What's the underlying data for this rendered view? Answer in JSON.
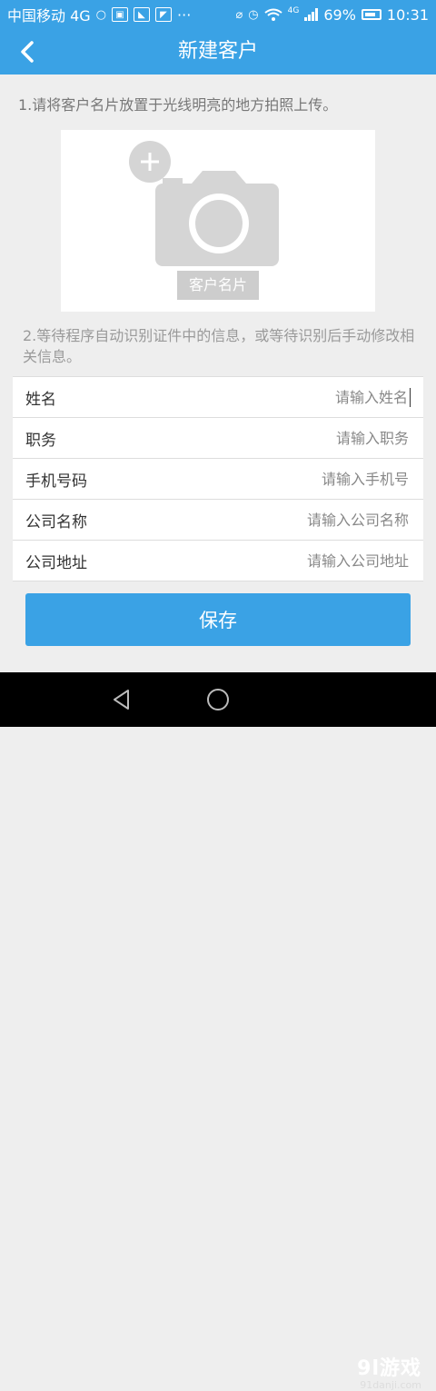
{
  "status_bar": {
    "carrier": "中国移动 4G",
    "icons": [
      "message-icon",
      "notification-icon",
      "image-icon",
      "photo-icon",
      "more-dots-icon",
      "mute-icon",
      "alarm-icon",
      "wifi-icon",
      "signal-icon",
      "battery-icon"
    ],
    "more": "···",
    "network": "4G",
    "battery": "69%",
    "time": "10:31"
  },
  "header": {
    "title": "新建客户",
    "back_icon": "back-arrow-icon"
  },
  "instructions": {
    "step1": "1.请将客户名片放置于光线明亮的地方拍照上传。",
    "step2": "2.等待程序自动识别证件中的信息，或等待识别后手动修改相关信息。"
  },
  "photo_card": {
    "label": "客户名片",
    "add_icon": "plus-icon",
    "camera_icon": "camera-icon"
  },
  "form": {
    "fields": [
      {
        "label": "姓名",
        "placeholder": "请输入姓名"
      },
      {
        "label": "职务",
        "placeholder": "请输入职务"
      },
      {
        "label": "手机号码",
        "placeholder": "请输入手机号"
      },
      {
        "label": "公司名称",
        "placeholder": "请输入公司名称"
      },
      {
        "label": "公司地址",
        "placeholder": "请输入公司地址"
      }
    ]
  },
  "save_button": "保存",
  "nav_bar": {
    "icons": [
      "back-triangle-icon",
      "home-circle-icon"
    ]
  },
  "watermark": {
    "brand": "9l游戏",
    "url": "91danji.com"
  },
  "colors": {
    "primary": "#3aa2e5",
    "background": "#eeeeee",
    "card_placeholder": "#d5d5d5"
  }
}
